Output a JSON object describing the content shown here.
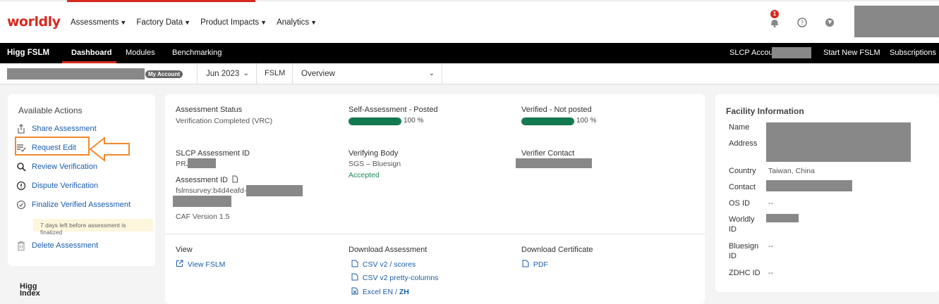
{
  "topnav": {
    "logo": "worldly",
    "menu": [
      {
        "label": "Assessments"
      },
      {
        "label": "Factory Data"
      },
      {
        "label": "Product Impacts"
      },
      {
        "label": "Analytics"
      }
    ],
    "notification_count": "1",
    "colors": {
      "brand": "#d62b1f"
    }
  },
  "subnav": {
    "brand": "Higg FSLM",
    "tabs": [
      {
        "label": "Dashboard",
        "active": true
      },
      {
        "label": "Modules"
      },
      {
        "label": "Benchmarking"
      }
    ],
    "right_links": [
      {
        "label": "SLCP Account FA"
      },
      {
        "label": "Start New FSLM"
      },
      {
        "label": "Subscriptions"
      }
    ]
  },
  "context_bar": {
    "my_account_badge": "My Account",
    "period": "Jun 2023",
    "module": "FSLM",
    "view": "Overview"
  },
  "actions": {
    "title": "Available Actions",
    "items": [
      {
        "label": "Share Assessment",
        "icon": "share-icon"
      },
      {
        "label": "Request Edit",
        "icon": "request-edit-icon"
      },
      {
        "label": "Review Verification",
        "icon": "search-icon"
      },
      {
        "label": "Dispute Verification",
        "icon": "alert-icon"
      },
      {
        "label": "Finalize Verified Assessment",
        "icon": "check-circle-icon"
      },
      {
        "label": "Delete Assessment",
        "icon": "trash-icon"
      }
    ],
    "finalize_note": "7 days left before assessment is finalized"
  },
  "footer_logo": {
    "line1": "Higg",
    "line2": "Index"
  },
  "assessment": {
    "status_label": "Assessment Status",
    "status_value": "Verification Completed (VRC)",
    "self_label": "Self-Assessment - Posted",
    "self_pct_text": "100 %",
    "self_progress": 1.0,
    "verified_label": "Verified - Not posted",
    "verified_pct_text": "100 %",
    "verified_progress": 1.0,
    "slcp_id_label": "SLCP Assessment ID",
    "slcp_id_value": "PRJ",
    "verifying_body_label": "Verifying Body",
    "verifying_body_value": "SGS – Bluesign",
    "verifying_body_status": "Accepted",
    "verifier_contact_label": "Verifier Contact",
    "assessment_id_label": "Assessment ID",
    "assessment_id_value": "fslmsurvey:b4d4eafd-",
    "caf_version": "CAF Version 1.5",
    "view_label": "View",
    "view_link": "View FSLM",
    "download_label": "Download Assessment",
    "download_links": [
      {
        "label": "CSV v2 / scores"
      },
      {
        "label": "CSV v2 pretty-columns"
      },
      {
        "label": "Excel EN / "
      }
    ],
    "excel_zh": "ZH",
    "certificate_label": "Download Certificate",
    "certificate_link": "PDF",
    "colors": {
      "progress": "#137a50",
      "link": "#1a5dab"
    }
  },
  "facility": {
    "title": "Facility Information",
    "name_label": "Name",
    "address_label": "Address",
    "country_label": "Country",
    "country_value": "Taiwan, China",
    "contact_label": "Contact",
    "osid_label": "OS ID",
    "osid_value": "--",
    "worldly_label_1": "Worldly",
    "worldly_label_2": "ID",
    "bluesign_label_1": "Bluesign",
    "bluesign_label_2": "ID",
    "bluesign_value": "--",
    "zdhc_label": "ZDHC ID",
    "zdhc_value": "--"
  }
}
